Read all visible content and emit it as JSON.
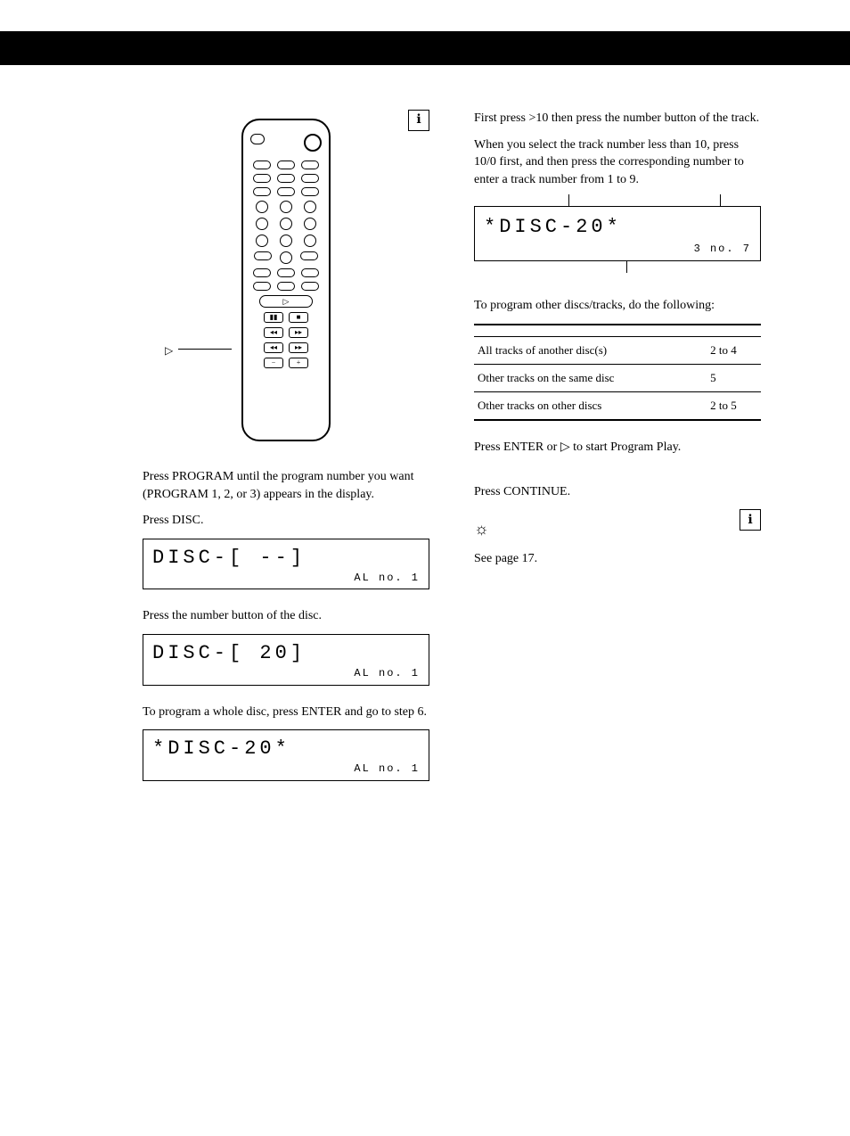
{
  "left": {
    "step1": "Press PROGRAM until the program number you want (PROGRAM 1, 2, or 3) appears in the display.",
    "step2": "Press DISC.",
    "display1_main": "DISC-[   --]",
    "display1_sub": "AL  no.  1",
    "step3": "Press the number button of the disc.",
    "display2_main": "DISC-[  20]",
    "display2_sub": "AL  no.  1",
    "step4": "To program a whole disc, press ENTER and go to step 6.",
    "display3_main": "*DISC-20*",
    "display3_sub": "AL  no.  1"
  },
  "right": {
    "intro1": "First press >10 then press the number button of the track.",
    "intro2": "When you select the track number less than 10, press 10/0 first, and then press the corresponding number to enter a track number from 1 to 9.",
    "display_main": "*DISC-20*",
    "display_sub": "3  no.  7",
    "step6": "To program other discs/tracks, do the following:",
    "table": {
      "r1c1": "All tracks of another disc(s)",
      "r1c2": "2 to 4",
      "r2c1": "Other tracks on the same disc",
      "r2c2": "5",
      "r3c1": "Other tracks on other discs",
      "r3c2": "2 to 5"
    },
    "step_enter": "Press ENTER or ▷ to start Program Play.",
    "step_cancel": "Press CONTINUE.",
    "tip_ref": "See page 17."
  }
}
